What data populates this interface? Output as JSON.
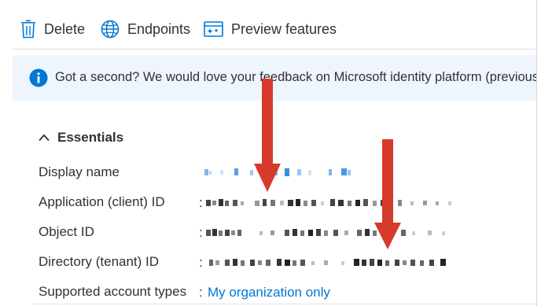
{
  "toolbar": {
    "delete_label": "Delete",
    "endpoints_label": "Endpoints",
    "preview_label": "Preview features"
  },
  "banner": {
    "message": "Got a second? We would love your feedback on Microsoft identity platform (previously"
  },
  "essentials": {
    "title": "Essentials",
    "rows": [
      {
        "key": "Display name",
        "value": ""
      },
      {
        "key": "Application (client) ID",
        "separator": ":",
        "value": ""
      },
      {
        "key": "Object ID",
        "separator": ":",
        "value": ""
      },
      {
        "key": "Directory (tenant) ID",
        "separator": ":",
        "value": ""
      },
      {
        "key": "Supported account types",
        "separator": ":",
        "value": "My organization only"
      }
    ]
  },
  "colors": {
    "accent": "#0078d4",
    "banner_bg": "#eef5fd",
    "arrow": "#d63a2a"
  }
}
